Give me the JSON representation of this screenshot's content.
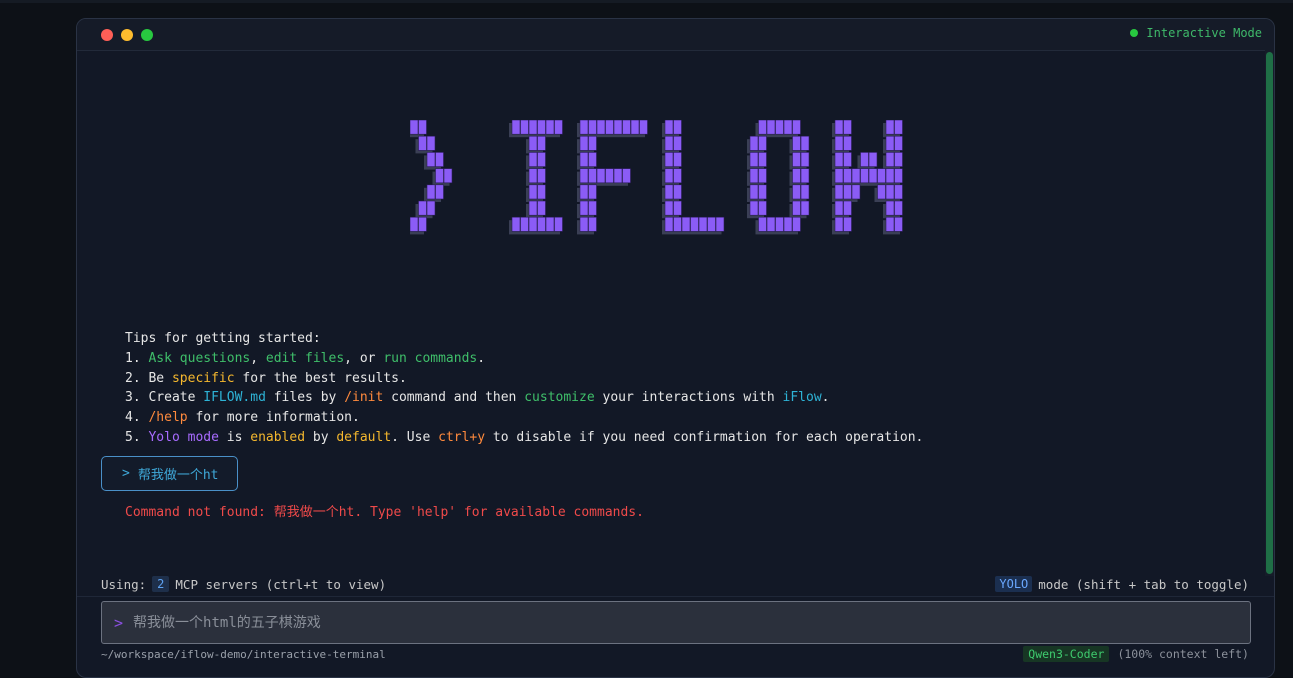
{
  "window": {
    "mode_label": "Interactive Mode",
    "colors": {
      "close": "#ff5f57",
      "minimize": "#febc2e",
      "maximize": "#28c840",
      "accent": "#28c840"
    }
  },
  "logo": {
    "text": "IFLOW",
    "color": "#8b5cf6"
  },
  "tips": {
    "heading": "Tips for getting started:",
    "lines": [
      [
        {
          "t": "1. ",
          "c": ""
        },
        {
          "t": "Ask questions",
          "c": "g"
        },
        {
          "t": ", ",
          "c": ""
        },
        {
          "t": "edit files",
          "c": "g"
        },
        {
          "t": ", or ",
          "c": ""
        },
        {
          "t": "run commands",
          "c": "g"
        },
        {
          "t": ".",
          "c": ""
        }
      ],
      [
        {
          "t": "2. Be ",
          "c": ""
        },
        {
          "t": "specific",
          "c": "y"
        },
        {
          "t": " for the best results.",
          "c": ""
        }
      ],
      [
        {
          "t": "3. Create ",
          "c": ""
        },
        {
          "t": "IFLOW.md",
          "c": "c"
        },
        {
          "t": " files by ",
          "c": ""
        },
        {
          "t": "/init",
          "c": "o"
        },
        {
          "t": " command and then ",
          "c": ""
        },
        {
          "t": "customize",
          "c": "g"
        },
        {
          "t": " your interactions with ",
          "c": ""
        },
        {
          "t": "iFlow",
          "c": "c"
        },
        {
          "t": ".",
          "c": ""
        }
      ],
      [
        {
          "t": "4. ",
          "c": ""
        },
        {
          "t": "/help",
          "c": "o"
        },
        {
          "t": " for more information.",
          "c": ""
        }
      ],
      [
        {
          "t": "5. ",
          "c": ""
        },
        {
          "t": "Yolo mode",
          "c": "p"
        },
        {
          "t": " is ",
          "c": ""
        },
        {
          "t": "enabled",
          "c": "y"
        },
        {
          "t": " by ",
          "c": ""
        },
        {
          "t": "default",
          "c": "y"
        },
        {
          "t": ". Use ",
          "c": ""
        },
        {
          "t": "ctrl+y",
          "c": "o"
        },
        {
          "t": " to disable if you need confirmation for each operation.",
          "c": ""
        }
      ]
    ]
  },
  "history": {
    "prompt_glyph": ">",
    "command_text": "帮我做一个ht",
    "error_text": "Command not found: 帮我做一个ht. Type 'help' for available commands."
  },
  "status": {
    "using_label": "Using:",
    "mcp_count": "2",
    "mcp_text": "MCP servers (ctrl+t to view)",
    "yolo_badge": "YOLO",
    "yolo_text": "mode (shift + tab to toggle)"
  },
  "input": {
    "prompt_glyph": ">",
    "placeholder": "帮我做一个html的五子棋游戏"
  },
  "footer": {
    "path": "~/workspace/iflow-demo/interactive-terminal",
    "model": "Qwen3-Coder",
    "context": "(100% context left)"
  }
}
